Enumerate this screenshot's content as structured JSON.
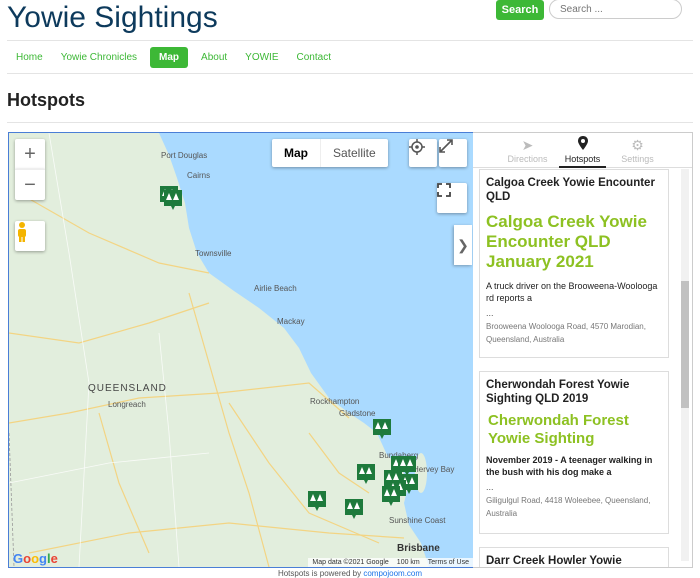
{
  "site": {
    "title": "Yowie Sightings"
  },
  "search": {
    "button_label": "Search",
    "placeholder": "Search ..."
  },
  "nav": {
    "items": [
      "Home",
      "Yowie Chronicles",
      "Map",
      "About",
      "YOWIE",
      "Contact"
    ],
    "active": "Map"
  },
  "page": {
    "title": "Hotspots"
  },
  "map": {
    "map_type": {
      "map": "Map",
      "satellite": "Satellite"
    },
    "labels": {
      "state": "QUEENSLAND",
      "cities": [
        "Port Douglas",
        "Cairns",
        "Townsville",
        "Airlie Beach",
        "Mackay",
        "Rockhampton",
        "Gladstone",
        "Longreach",
        "Bundaberg",
        "Hervey Bay",
        "Sunshine Coast",
        "Brisbane"
      ]
    },
    "google_logo": "Google",
    "attribution": {
      "data": "Map data ©2021 Google",
      "scale": "100 km",
      "terms": "Terms of Use"
    },
    "zoom_in": "+",
    "zoom_out": "−",
    "toggle": "❯"
  },
  "sidebar": {
    "tabs": [
      {
        "label": "Directions",
        "icon": "navigation-arrow-icon"
      },
      {
        "label": "Hotspots",
        "icon": "map-pin-icon"
      },
      {
        "label": "Settings",
        "icon": "gear-icon"
      }
    ],
    "active_tab": "Hotspots",
    "cards": [
      {
        "title": "Calgoa Creek Yowie Encounter QLD",
        "heading": "Calgoa Creek Yowie Encounter QLD January 2021",
        "text": "A truck driver on the Brooweena-Woolooga rd reports a",
        "dots": "...",
        "address": "Brooweena Woolooga Road, 4570 Marodian, Queensland, Australia"
      },
      {
        "title": "Cherwondah Forest Yowie Sighting QLD 2019",
        "heading": "Cherwondah Forest Yowie Sighting",
        "text": "November 2019 - A teenager walking in the bush with his dog make a",
        "dots": "...",
        "address": "Giligulgul Road, 4418 Woleebee, Queensland, Australia"
      },
      {
        "title": "Darr Creek Howler Yowie"
      }
    ]
  },
  "footer": {
    "text": "Hotspots is powered by",
    "link": "compojoom.com"
  },
  "colors": {
    "accent": "#3db836",
    "card_heading": "#8dc122",
    "title": "#0d3a5c",
    "water": "#aadaff",
    "land": "#dcefd9",
    "marker": "#1e7a3c"
  }
}
